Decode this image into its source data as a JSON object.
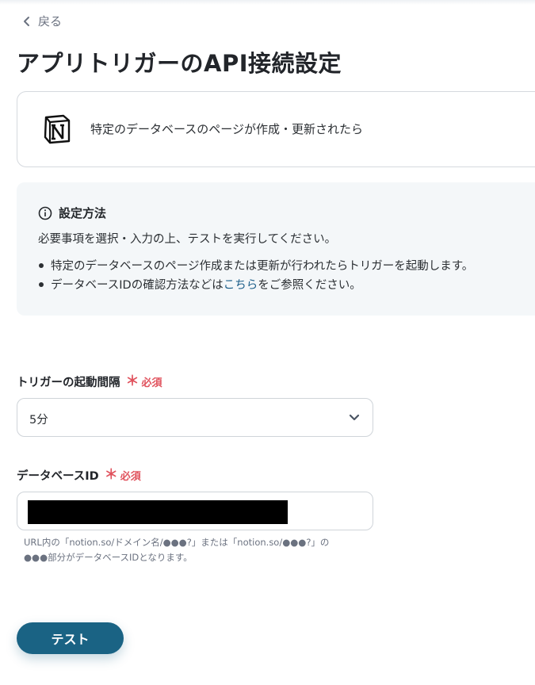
{
  "nav": {
    "back_label": "戻る"
  },
  "page": {
    "title": "アプリトリガーのAPI接続設定"
  },
  "app_card": {
    "app_icon": "notion-logo",
    "trigger_text": "特定のデータベースのページが作成・更新されたら"
  },
  "info": {
    "title": "設定方法",
    "description": "必要事項を選択・入力の上、テストを実行してください。",
    "bullets": [
      "特定のデータベースのページ作成または更新が行われたらトリガーを起動します。"
    ],
    "bullet2_prefix": "データベースIDの確認方法などは",
    "bullet2_link": "こちら",
    "bullet2_suffix": "をご参照ください。"
  },
  "fields": {
    "interval": {
      "label": "トリガーの起動間隔",
      "required_mark": "＊",
      "required_label": "必須",
      "value": "5分"
    },
    "database_id": {
      "label": "データベースID",
      "required_mark": "＊",
      "required_label": "必須",
      "value_redacted": true,
      "hint_line1": "URL内の「notion.so/ドメイン名/●●●?」または「notion.so/●●●?」の",
      "hint_line2": "●●●部分がデータベースIDとなります。"
    }
  },
  "actions": {
    "test_label": "テスト"
  },
  "colors": {
    "accent": "#1a6384",
    "required": "#e0525d",
    "link": "#1d5f8a",
    "info_bg": "#f4f7f9"
  }
}
